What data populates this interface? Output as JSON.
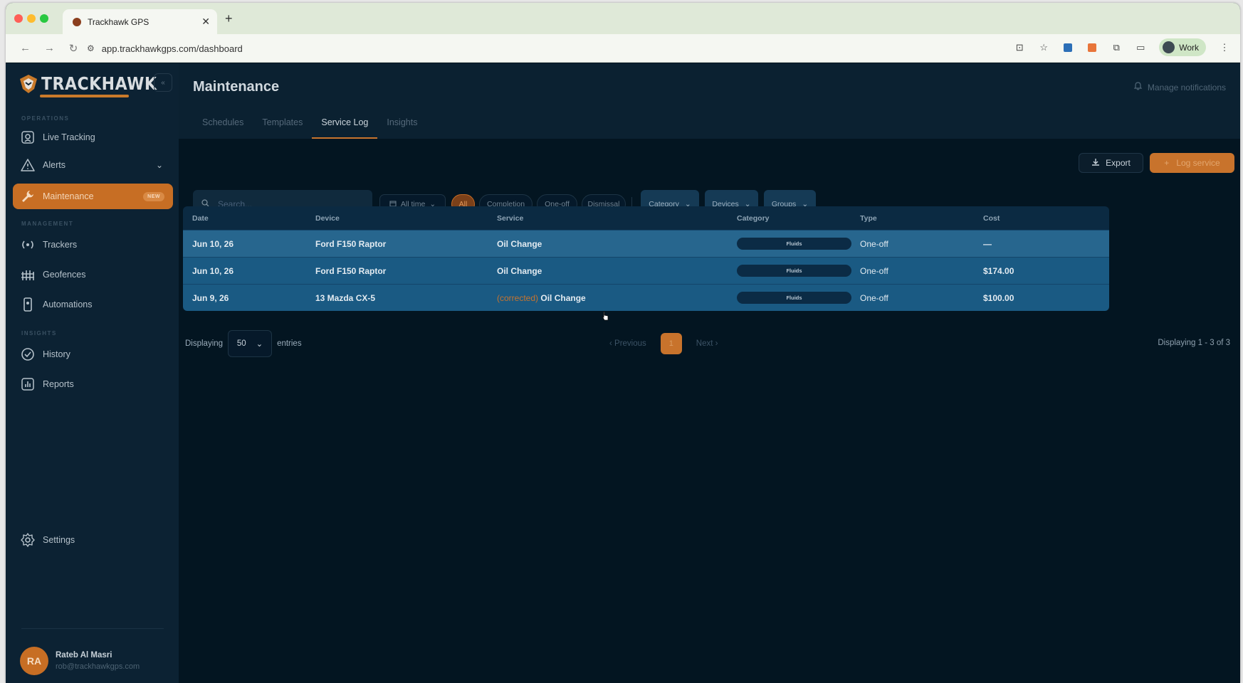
{
  "browser": {
    "tab_title": "Trackhawk GPS",
    "url": "app.trackhawkgps.com/dashboard",
    "profile_label": "Work"
  },
  "brand": {
    "name": "TRACKHAWK",
    "accent_color": "#c8732c"
  },
  "sidebar": {
    "sections": {
      "operations": "OPERATIONS",
      "management": "MANAGEMENT",
      "insights": "INSIGHTS"
    },
    "items": [
      {
        "label": "Live Tracking",
        "icon": "map-pin-icon"
      },
      {
        "label": "Alerts",
        "icon": "warning-icon"
      },
      {
        "label": "Maintenance",
        "icon": "wrench-icon",
        "badge": "NEW",
        "active": true
      },
      {
        "label": "Trackers",
        "icon": "signal-icon"
      },
      {
        "label": "Geofences",
        "icon": "fence-icon"
      },
      {
        "label": "Automations",
        "icon": "device-icon"
      },
      {
        "label": "History",
        "icon": "check-circle-icon"
      },
      {
        "label": "Reports",
        "icon": "bar-chart-icon"
      },
      {
        "label": "Settings",
        "icon": "gear-icon"
      }
    ],
    "user": {
      "initials": "RA",
      "name": "Rateb Al Masri",
      "email": "rob@trackhawkgps.com"
    }
  },
  "header": {
    "title": "Maintenance",
    "manage_notifications": "Manage notifications",
    "tabs": [
      "Schedules",
      "Templates",
      "Service Log",
      "Insights"
    ],
    "active_tab": "Service Log"
  },
  "actions": {
    "export_label": "Export",
    "log_label": "Log service"
  },
  "filters": {
    "search_placeholder": "Search...",
    "time_range": "All time",
    "pills": [
      "All",
      "Completion",
      "One-off",
      "Dismissal"
    ],
    "active_pill": "All",
    "dropdowns": [
      "Category",
      "Devices",
      "Groups"
    ]
  },
  "table": {
    "columns": [
      "Date",
      "Device",
      "Service",
      "Category",
      "Type",
      "Cost"
    ],
    "rows": [
      {
        "date": "Jun 10, 26",
        "device": "Ford F150 Raptor",
        "prefix": "",
        "service": "Oil Change",
        "category": "Fluids",
        "type": "One-off",
        "cost": "—"
      },
      {
        "date": "Jun 10, 26",
        "device": "Ford F150 Raptor",
        "prefix": "",
        "service": "Oil Change",
        "category": "Fluids",
        "type": "One-off",
        "cost": "$174.00"
      },
      {
        "date": "Jun 9, 26",
        "device": "13 Mazda CX-5",
        "prefix": "(corrected)",
        "service": "Oil Change",
        "category": "Fluids",
        "type": "One-off",
        "cost": "$100.00"
      }
    ]
  },
  "pagination": {
    "displaying_label": "Displaying",
    "per_page": "50",
    "entries_label": "entries",
    "previous": "Previous",
    "current_page": "1",
    "next": "Next",
    "summary": "Displaying 1 - 3 of 3"
  }
}
